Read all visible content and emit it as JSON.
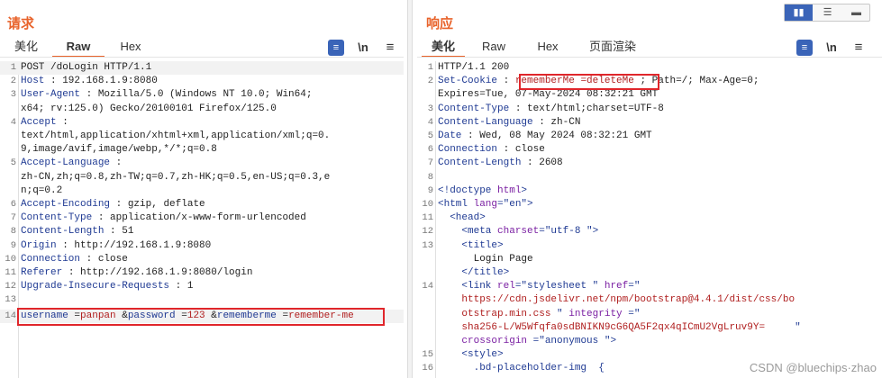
{
  "left": {
    "title": "请求",
    "tabs": [
      "美化",
      "Raw",
      "Hex"
    ],
    "active_tab": "Raw",
    "icons": [
      "wrap-icon",
      "newline-icon",
      "menu-icon"
    ],
    "icon_glyphs": [
      "\\n",
      "≡"
    ],
    "lines": [
      {
        "n": "1",
        "k": "POST /doLogin HTTP/1.1",
        "v": ""
      },
      {
        "n": "2",
        "k": "Host",
        "v": " : 192.168.1.9:8080"
      },
      {
        "n": "3",
        "k": "User-Agent",
        "v": " : Mozilla/5.0 (Windows NT 10.0; Win64;"
      },
      {
        "n": "",
        "k": "",
        "v": "x64; rv:125.0) Gecko/20100101 Firefox/125.0"
      },
      {
        "n": "4",
        "k": "Accept",
        "v": " :"
      },
      {
        "n": "",
        "k": "",
        "v": "text/html,application/xhtml+xml,application/xml;q=0."
      },
      {
        "n": "",
        "k": "",
        "v": "9,image/avif,image/webp,*/*;q=0.8"
      },
      {
        "n": "5",
        "k": "Accept-Language",
        "v": " :"
      },
      {
        "n": "",
        "k": "",
        "v": "zh-CN,zh;q=0.8,zh-TW;q=0.7,zh-HK;q=0.5,en-US;q=0.3,e"
      },
      {
        "n": "",
        "k": "",
        "v": "n;q=0.2"
      },
      {
        "n": "6",
        "k": "Accept-Encoding",
        "v": " : gzip, deflate"
      },
      {
        "n": "7",
        "k": "Content-Type",
        "v": " : application/x-www-form-urlencoded"
      },
      {
        "n": "8",
        "k": "Content-Length",
        "v": " : 51"
      },
      {
        "n": "9",
        "k": "Origin",
        "v": " : http://192.168.1.9:8080"
      },
      {
        "n": "10",
        "k": "Connection",
        "v": " : close"
      },
      {
        "n": "11",
        "k": "Referer",
        "v": " : http://192.168.1.9:8080/login"
      },
      {
        "n": "12",
        "k": "Upgrade-Insecure-Requests",
        "v": " : 1"
      },
      {
        "n": "13",
        "k": "",
        "v": ""
      }
    ],
    "body_line": {
      "n": "14",
      "parts": [
        {
          "t": "username",
          "c": "blue"
        },
        {
          "t": " =",
          "c": "hd"
        },
        {
          "t": "panpan",
          "c": "red"
        },
        {
          "t": " &",
          "c": "hd"
        },
        {
          "t": "password",
          "c": "blue"
        },
        {
          "t": " =",
          "c": "hd"
        },
        {
          "t": "123",
          "c": "red"
        },
        {
          "t": " &",
          "c": "hd"
        },
        {
          "t": "rememberme",
          "c": "blue"
        },
        {
          "t": " =",
          "c": "hd"
        },
        {
          "t": "remember-me",
          "c": "red"
        }
      ]
    }
  },
  "right": {
    "title": "响应",
    "tabs": [
      "美化",
      "Raw",
      "Hex",
      "页面渲染"
    ],
    "active_tab": "美化",
    "icons": [
      "wrap-icon",
      "newline-icon",
      "menu-icon"
    ],
    "icon_glyphs": [
      "\\n",
      "≡"
    ],
    "lines": [
      {
        "n": "1",
        "parts": [
          {
            "t": "HTTP/1.1 200",
            "c": "hd"
          }
        ]
      },
      {
        "n": "2",
        "parts": [
          {
            "t": "Set-Cookie",
            "c": "hk"
          },
          {
            "t": " : ",
            "c": "hd"
          },
          {
            "t": "rememberMe =deleteMe",
            "c": "red"
          },
          {
            "t": " ; Path=/; Max-Age=0;",
            "c": "hd"
          }
        ]
      },
      {
        "n": "",
        "parts": [
          {
            "t": "Expires=Tue, 07-May-2024 08:32:21 GMT",
            "c": "hd"
          }
        ]
      },
      {
        "n": "3",
        "parts": [
          {
            "t": "Content-Type",
            "c": "hk"
          },
          {
            "t": " : text/html;charset=UTF-8",
            "c": "hd"
          }
        ]
      },
      {
        "n": "4",
        "parts": [
          {
            "t": "Content-Language",
            "c": "hk"
          },
          {
            "t": " : zh-CN",
            "c": "hd"
          }
        ]
      },
      {
        "n": "5",
        "parts": [
          {
            "t": "Date",
            "c": "hk"
          },
          {
            "t": " : Wed, 08 May 2024 08:32:21 GMT",
            "c": "hd"
          }
        ]
      },
      {
        "n": "6",
        "parts": [
          {
            "t": "Connection",
            "c": "hk"
          },
          {
            "t": " : close",
            "c": "hd"
          }
        ]
      },
      {
        "n": "7",
        "parts": [
          {
            "t": "Content-Length",
            "c": "hk"
          },
          {
            "t": " : 2608",
            "c": "hd"
          }
        ]
      },
      {
        "n": "8",
        "parts": []
      },
      {
        "n": "9",
        "parts": [
          {
            "t": "<!doctype ",
            "c": "hk"
          },
          {
            "t": "html",
            "c": "purple"
          },
          {
            "t": ">",
            "c": "hk"
          }
        ]
      },
      {
        "n": "10",
        "parts": [
          {
            "t": "<html ",
            "c": "hk"
          },
          {
            "t": "lang",
            "c": "purple"
          },
          {
            "t": "=\"en\">",
            "c": "hk"
          }
        ]
      },
      {
        "n": "11",
        "parts": [
          {
            "t": "  <head>",
            "c": "hk"
          }
        ]
      },
      {
        "n": "12",
        "parts": [
          {
            "t": "    <meta ",
            "c": "hk"
          },
          {
            "t": "charset",
            "c": "purple"
          },
          {
            "t": "=\"utf-8 \">",
            "c": "hk"
          }
        ]
      },
      {
        "n": "13",
        "parts": [
          {
            "t": "    <title>",
            "c": "hk"
          }
        ]
      },
      {
        "n": "",
        "parts": [
          {
            "t": "      Login Page",
            "c": "hd"
          }
        ]
      },
      {
        "n": "",
        "parts": [
          {
            "t": "    </title>",
            "c": "hk"
          }
        ]
      },
      {
        "n": "14",
        "parts": [
          {
            "t": "    <link ",
            "c": "hk"
          },
          {
            "t": "rel",
            "c": "purple"
          },
          {
            "t": "=\"stylesheet \" ",
            "c": "hk"
          },
          {
            "t": "href",
            "c": "purple"
          },
          {
            "t": "=\"",
            "c": "hk"
          }
        ]
      },
      {
        "n": "",
        "parts": [
          {
            "t": "    https://cdn.jsdelivr.net/npm/bootstrap@4.4.1/dist/css/bo",
            "c": "red"
          }
        ]
      },
      {
        "n": "",
        "parts": [
          {
            "t": "    otstrap.min.css",
            "c": "red"
          },
          {
            "t": " \" ",
            "c": "hk"
          },
          {
            "t": "integrity",
            "c": "purple"
          },
          {
            "t": " =\"",
            "c": "hk"
          }
        ]
      },
      {
        "n": "",
        "parts": [
          {
            "t": "    sha256-L/W5Wfqfa0sdBNIKN9cG6QA5F2qx4qICmU2VgLruv9Y=",
            "c": "red"
          },
          {
            "t": "     \"",
            "c": "hk"
          }
        ]
      },
      {
        "n": "",
        "parts": [
          {
            "t": "    ",
            "c": "hd"
          },
          {
            "t": "crossorigin",
            "c": "purple"
          },
          {
            "t": " =\"anonymous \">",
            "c": "hk"
          }
        ]
      },
      {
        "n": "15",
        "parts": [
          {
            "t": "    <style>",
            "c": "hk"
          }
        ]
      },
      {
        "n": "16",
        "parts": [
          {
            "t": "      .bd-placeholder-img  {",
            "c": "hk"
          }
        ]
      }
    ]
  },
  "view_buttons": [
    "split-vertical",
    "split-horizontal",
    "single"
  ],
  "watermark": "CSDN @bluechips·zhao"
}
